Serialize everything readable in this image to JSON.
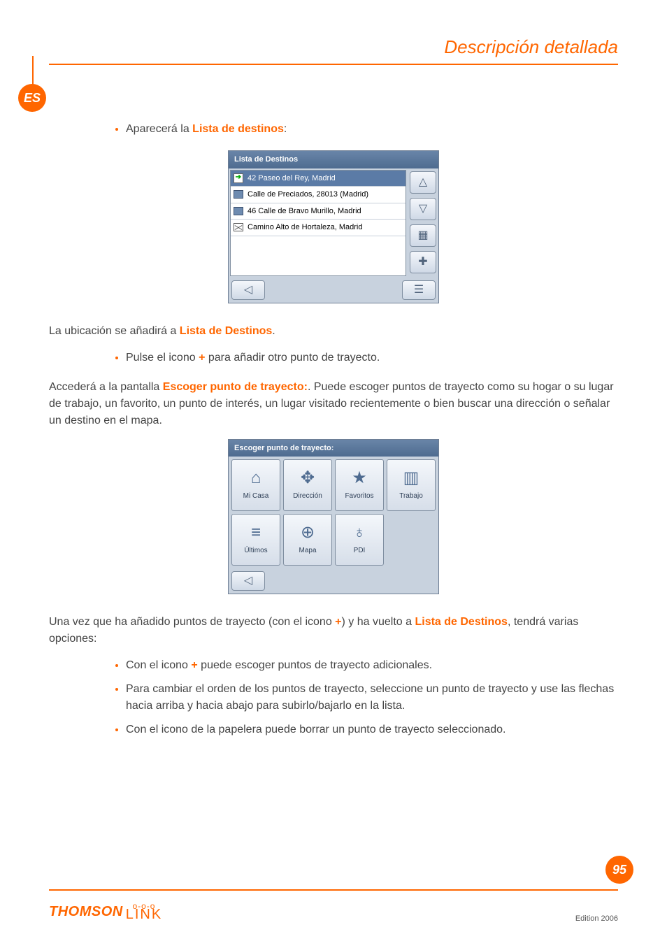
{
  "header": {
    "title": "Descripción detallada"
  },
  "lang_badge": "ES",
  "intro_bullet": {
    "pre": "Aparecerá la ",
    "bold": "Lista de destinos",
    "post": ":"
  },
  "screenshot1": {
    "title": "Lista de Destinos",
    "rows": [
      {
        "icon": "arrow-right-icon",
        "text": "42 Paseo del Rey, Madrid",
        "selected": true
      },
      {
        "icon": "square-icon",
        "text": "Calle de Preciados, 28013 (Madrid)",
        "selected": false
      },
      {
        "icon": "square-icon",
        "text": "46 Calle de Bravo Murillo, Madrid",
        "selected": false
      },
      {
        "icon": "crossed-icon",
        "text": "Camino Alto de Hortaleza, Madrid",
        "selected": false
      }
    ],
    "side_buttons": [
      "up-icon",
      "down-icon",
      "trash-icon",
      "plus-icon"
    ],
    "footer_left": "back-icon",
    "footer_right": "menu-icon"
  },
  "para_after1": {
    "pre": "La ubicación se añadirá a ",
    "bold": "Lista de Destinos",
    "post": "."
  },
  "bullet_plus": {
    "pre": "Pulse el icono ",
    "bold": "+",
    "post": " para añadir otro punto de trayecto."
  },
  "para_escoger": {
    "pre": "Accederá a la pantalla ",
    "bold": "Escoger punto de trayecto:",
    "post": ". Puede escoger puntos de trayecto como su hogar o su lugar de trabajo, un favorito, un punto de interés, un lugar visitado recientemente o bien buscar una dirección o señalar un destino en el mapa."
  },
  "screenshot2": {
    "title": "Escoger punto de trayecto:",
    "cells": [
      {
        "icon": "home-icon",
        "glyph": "⌂",
        "label": "Mi Casa"
      },
      {
        "icon": "target-icon",
        "glyph": "✥",
        "label": "Dirección"
      },
      {
        "icon": "star-list-icon",
        "glyph": "★",
        "label": "Favoritos"
      },
      {
        "icon": "building-icon",
        "glyph": "▥",
        "label": "Trabajo"
      },
      {
        "icon": "recent-icon",
        "glyph": "≡",
        "label": "Últimos"
      },
      {
        "icon": "globe-icon",
        "glyph": "⊕",
        "label": "Mapa"
      },
      {
        "icon": "poi-icon",
        "glyph": "♁",
        "label": "PDI"
      }
    ],
    "footer_back": "back-icon"
  },
  "para_once": {
    "pre": "Una vez que ha añadido puntos de trayecto (con el icono ",
    "bold1": "+",
    "mid": ") y ha vuelto a ",
    "bold2": "Lista de Destinos",
    "post": ", tendrá varias opciones:"
  },
  "final_bullets": [
    {
      "pre": "Con el icono ",
      "bold": "+",
      "post": " puede escoger puntos de trayecto adicionales."
    },
    {
      "full": "Para cambiar el orden de los puntos de trayecto, seleccione un punto de trayecto y use las flechas hacia arriba y hacia abajo para subirlo/bajarlo en la lista."
    },
    {
      "full": "Con el icono de la papelera puede borrar un punto de trayecto seleccionado."
    }
  ],
  "page_number": "95",
  "brand": {
    "name": "THOMSON",
    "sub": "LINK",
    "dots": "o-o-o"
  },
  "edition": "Edition 2006"
}
